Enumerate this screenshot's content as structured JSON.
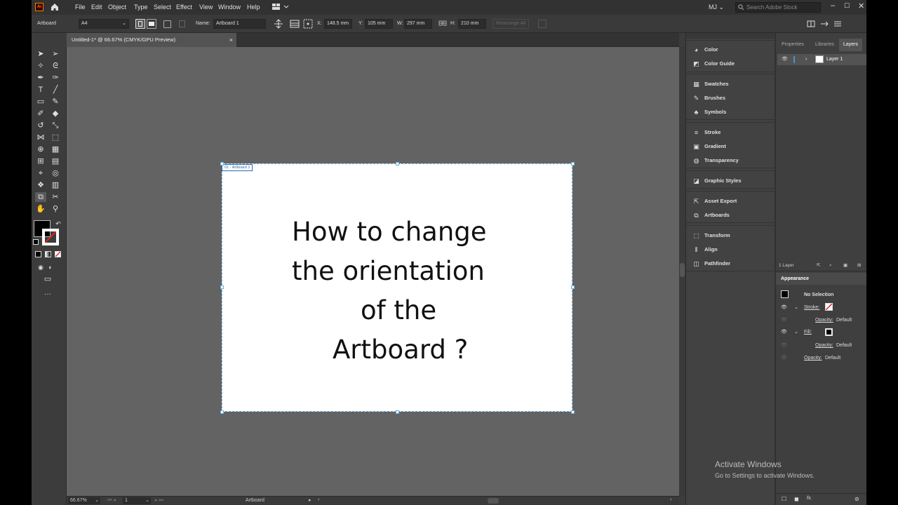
{
  "menu": {
    "app_logo": "Ai",
    "items": [
      "File",
      "Edit",
      "Object",
      "Type",
      "Select",
      "Effect",
      "View",
      "Window",
      "Help"
    ],
    "user_initials": "MJ",
    "search_placeholder": "Search Adobe Stock"
  },
  "control_bar": {
    "selection": "Artboard",
    "preset": "A4",
    "name_label": "Name:",
    "name_value": "Artboard 1",
    "x_label": "X:",
    "x_value": "148.5 mm",
    "y_label": "Y:",
    "y_value": "105 mm",
    "w_label": "W:",
    "w_value": "297 mm",
    "h_label": "H:",
    "h_value": "210 mm",
    "rearrange_label": "Rearrange All"
  },
  "document_tab": {
    "title": "Untitled-1* @ 66.67% (CMYK/GPU Preview)",
    "close": "×"
  },
  "artboard": {
    "label": "01 - Artboard 1",
    "headline": [
      "How to change",
      "the orientation",
      "of the",
      "Artboard ?"
    ]
  },
  "status_bar": {
    "zoom": "66.67%",
    "artboard_number": "1",
    "tool_name": "Artboard"
  },
  "dock_panels": [
    {
      "label": "Color",
      "icon": "color-icon"
    },
    {
      "label": "Color Guide",
      "icon": "color-guide-icon"
    },
    {
      "label": "Swatches",
      "icon": "swatches-icon"
    },
    {
      "label": "Brushes",
      "icon": "brushes-icon"
    },
    {
      "label": "Symbols",
      "icon": "symbols-icon"
    },
    {
      "label": "Stroke",
      "icon": "stroke-icon"
    },
    {
      "label": "Gradient",
      "icon": "gradient-icon"
    },
    {
      "label": "Transparency",
      "icon": "transparency-icon"
    },
    {
      "label": "Graphic Styles",
      "icon": "graphic-styles-icon"
    },
    {
      "label": "Asset Export",
      "icon": "asset-export-icon"
    },
    {
      "label": "Artboards",
      "icon": "artboards-icon"
    },
    {
      "label": "Transform",
      "icon": "transform-icon"
    },
    {
      "label": "Align",
      "icon": "align-icon"
    },
    {
      "label": "Pathfinder",
      "icon": "pathfinder-icon"
    }
  ],
  "layers_panel": {
    "tabs": [
      "Properties",
      "Libraries",
      "Layers"
    ],
    "active_tab": "Layers",
    "layer_name": "Layer 1",
    "layer_count": "1 Layer"
  },
  "appearance_panel": {
    "title": "Appearance",
    "selection": "No Selection",
    "stroke_label": "Stroke:",
    "opacity_label": "Opacity:",
    "opacity_value": "Default",
    "fill_label": "Fill:",
    "fx_label": "fx."
  },
  "watermark": {
    "title": "Activate Windows",
    "subtitle": "Go to Settings to activate Windows."
  },
  "colors": {
    "app_bg": "#3c3c3c",
    "canvas_bg": "#636363",
    "artboard_border": "#6fb1e0",
    "layer_highlight": "#4a8fd1",
    "logo_orange": "#ff7c00"
  }
}
